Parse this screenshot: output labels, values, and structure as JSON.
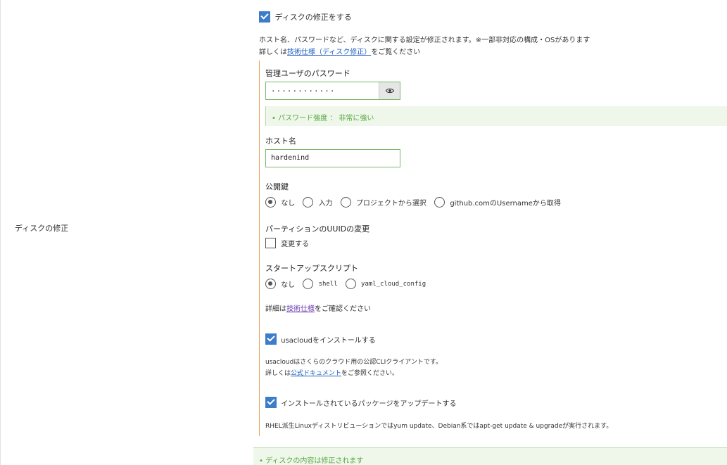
{
  "row_label": "ディスクの修正",
  "disk_edit": {
    "checkbox_label": "ディスクの修正をする",
    "checked": true,
    "description_line1": "ホスト名、パスワードなど、ディスクに関する設定が修正されます。※一部非対応の構成・OSがあります",
    "description_prefix": "詳しくは",
    "description_link": "技術仕様（ディスク修正）",
    "description_suffix": "をご覧ください"
  },
  "password": {
    "label": "管理ユーザのパスワード",
    "value": "············",
    "reveal_icon": "eye-icon",
    "strength": "• パスワード強度 ： 非常に強い"
  },
  "hostname": {
    "label": "ホスト名",
    "value": "hardenind"
  },
  "public_key": {
    "label": "公開鍵",
    "options": [
      "なし",
      "入力",
      "プロジェクトから選択",
      "github.comのUsernameから取得"
    ],
    "selected": "なし"
  },
  "uuid": {
    "label": "パーティションのUUIDの変更",
    "checkbox_label": "変更する",
    "checked": false
  },
  "startup_script": {
    "label": "スタートアップスクリプト",
    "options": [
      "なし",
      "shell",
      "yaml_cloud_config"
    ],
    "selected": "なし",
    "note_prefix": "詳細は",
    "note_link": "技術仕様",
    "note_suffix": "をご確認ください"
  },
  "usacloud": {
    "checkbox_label": "usacloudをインストールする",
    "checked": true,
    "desc_line1": "usacloudはさくらのクラウド用の公認CLIクライアントです。",
    "desc_prefix": "詳しくは",
    "desc_link": "公式ドキュメント",
    "desc_suffix": "をご参照ください。"
  },
  "update_packages": {
    "checkbox_label": "インストールされているパッケージをアップデートする",
    "checked": true,
    "desc": "RHEL派生Linuxディストリビューションではyum update、Debian系ではapt-get update & upgradeが実行されます。"
  },
  "bottom_notice": "• ディスクの内容は修正されます",
  "colors": {
    "checkbox_checked": "#3d7cc9",
    "panel_border": "#e8a15a",
    "success_text": "#5aa845",
    "success_bg": "#eef7ea",
    "link": "#1a5dbf"
  }
}
